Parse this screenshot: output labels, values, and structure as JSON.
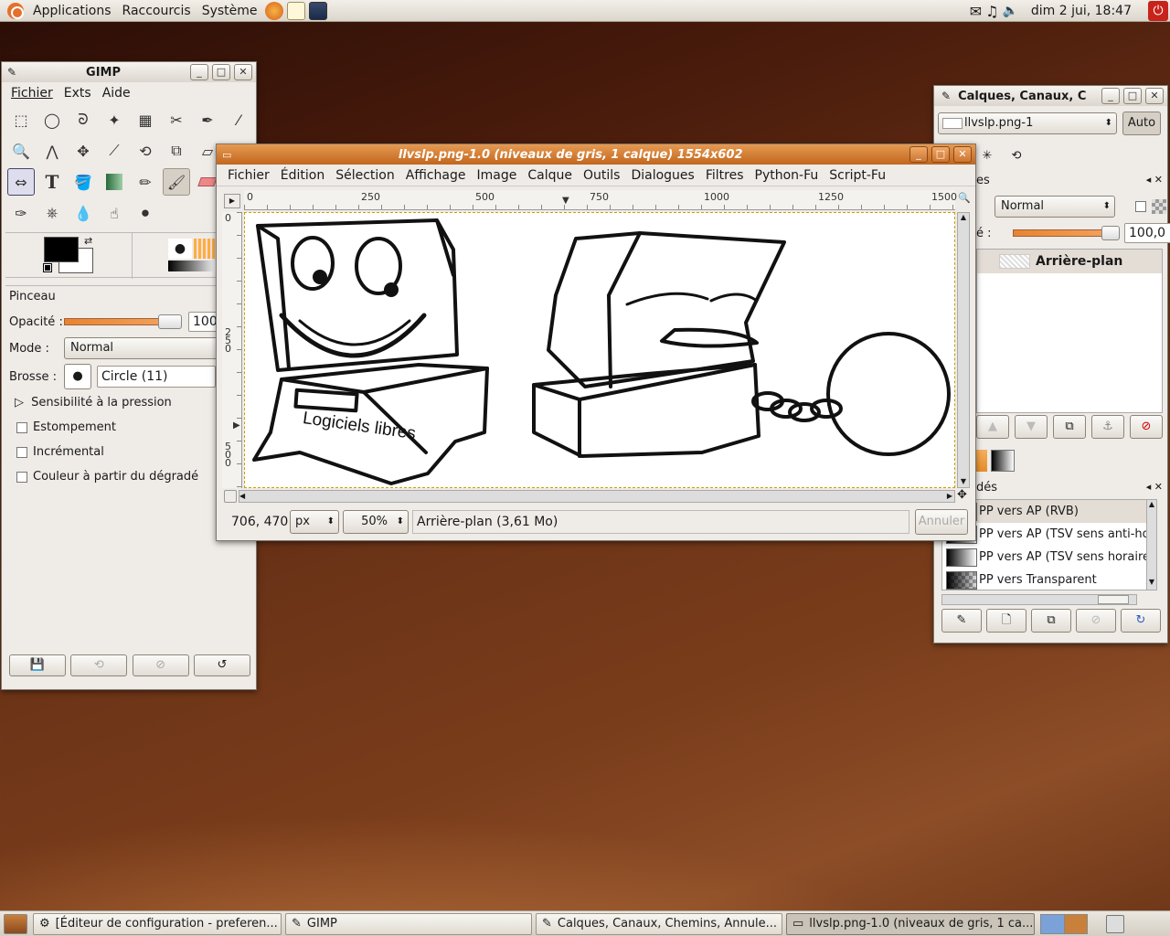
{
  "top_panel": {
    "menus": [
      "Applications",
      "Raccourcis",
      "Système"
    ],
    "clock": "dim  2 jui, 18:47"
  },
  "toolbox": {
    "title": "GIMP",
    "menu": [
      "Fichier",
      "Exts",
      "Aide"
    ],
    "tool_options": {
      "title": "Pinceau",
      "opacity_label": "Opacité :",
      "opacity_value": "100,0",
      "mode_label": "Mode :",
      "mode_value": "Normal",
      "brush_label": "Brosse :",
      "brush_value": "Circle (11)",
      "pressure_label": "Sensibilité à la pression",
      "fade_label": "Estompement",
      "incremental_label": "Incrémental",
      "gradient_color_label": "Couleur à partir du dégradé"
    }
  },
  "image_window": {
    "title": "llvslp.png-1.0 (niveaux de gris, 1 calque) 1554x602",
    "menu": [
      "Fichier",
      "Édition",
      "Sélection",
      "Affichage",
      "Image",
      "Calque",
      "Outils",
      "Dialogues",
      "Filtres",
      "Python-Fu",
      "Script-Fu"
    ],
    "hruler": [
      "0",
      "250",
      "500",
      "750",
      "1000",
      "1250",
      "1500"
    ],
    "vruler": [
      "0",
      "250",
      "500"
    ],
    "canvas_text": "Logiciels libres",
    "coords": "706, 470",
    "unit": "px",
    "zoom": "50%",
    "status": "Arrière-plan (3,61 Mo)",
    "cancel": "Annuler"
  },
  "layers": {
    "title": "Calques, Canaux, C",
    "image_select": "llvslp.png-1",
    "auto": "Auto",
    "tab_label": "es",
    "mode_value": "Normal",
    "opacity_label": "é :",
    "opacity_value": "100,0",
    "layer_name": "Arrière-plan",
    "gradients_title": "dés",
    "gradients": [
      "PP vers AP (RVB)",
      "PP vers AP (TSV sens anti-ho",
      "PP vers AP (TSV sens horaire",
      "PP vers Transparent"
    ]
  },
  "taskbar": {
    "tasks": [
      "[Éditeur de configuration - preferen...",
      "GIMP",
      "Calques, Canaux, Chemins, Annule...",
      "llvslp.png-1.0 (niveaux de gris, 1 ca..."
    ]
  },
  "colors": {
    "accent": "#d1762a",
    "panel": "#efebe7"
  }
}
